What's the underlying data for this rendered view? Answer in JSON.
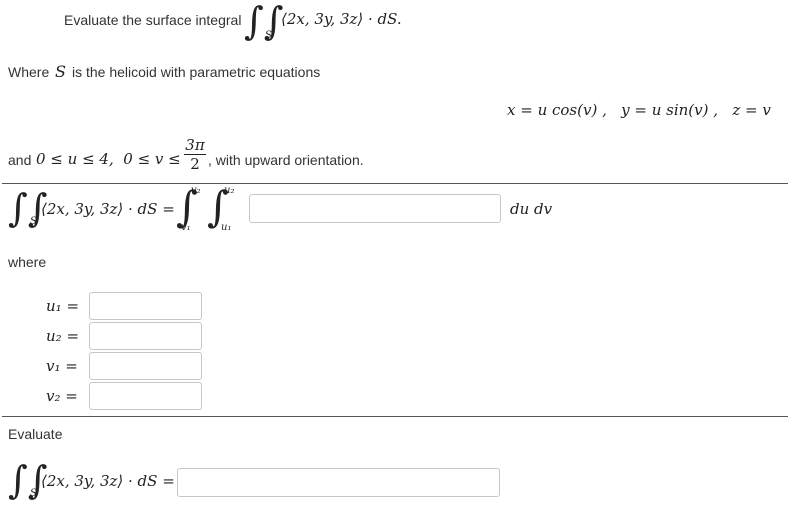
{
  "prompt": {
    "intro": "Evaluate the surface integral",
    "integrand": "⟨2x, 3y, 3z⟩ · dS.",
    "domain": "S",
    "where_prefix": "Where",
    "where_var": "S",
    "where_suffix": "is the helicoid with parametric equations",
    "param_eq": "x = u cos(v) ,   y = u sin(v) ,   z = v",
    "range_prefix": "and",
    "range_expr": "0 ≤ u ≤ 4,  0 ≤ v ≤",
    "range_num": "3π",
    "range_den": "2",
    "orientation": ", with upward orientation."
  },
  "setup": {
    "lhs": "⟨2x, 3y, 3z⟩ · dS =",
    "domain": "S",
    "outer_upper": "v₂",
    "outer_lower": "v₁",
    "inner_upper": "u₂",
    "inner_lower": "u₁",
    "differential": "du dv",
    "integrand_value": ""
  },
  "where_label": "where",
  "limits": [
    {
      "label": "u₁ =",
      "value": ""
    },
    {
      "label": "u₂ =",
      "value": ""
    },
    {
      "label": "v₁ =",
      "value": ""
    },
    {
      "label": "v₂ =",
      "value": ""
    }
  ],
  "evaluate": {
    "label": "Evaluate",
    "lhs": "⟨2x, 3y, 3z⟩ · dS =",
    "domain": "S",
    "value": ""
  }
}
